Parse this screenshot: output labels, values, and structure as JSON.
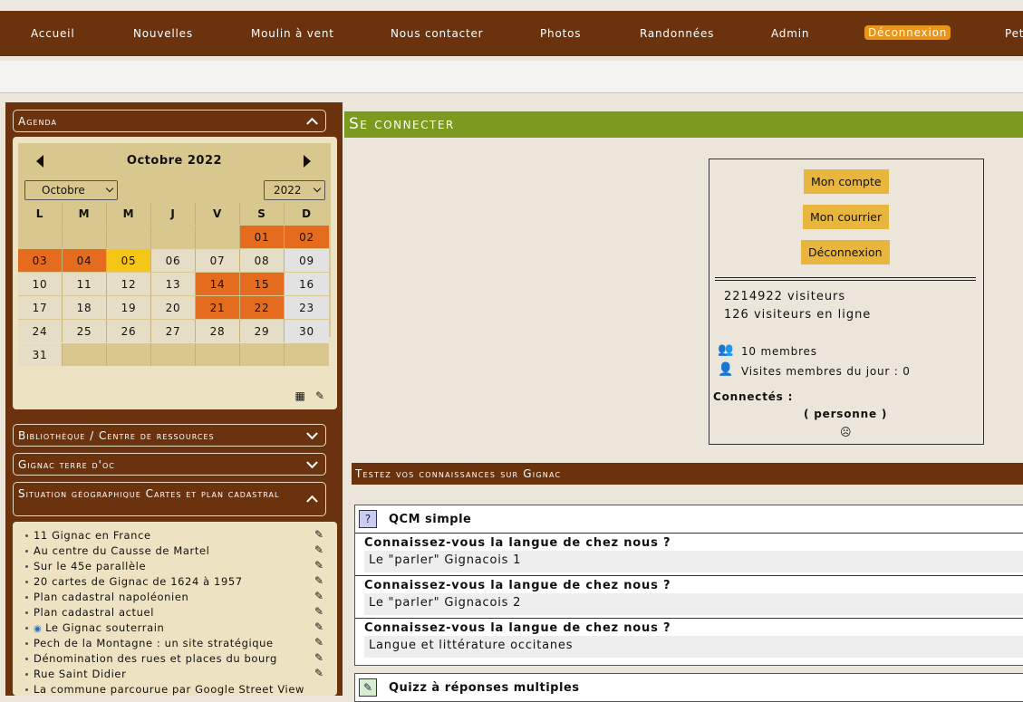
{
  "nav": {
    "items": [
      "Accueil",
      "Nouvelles",
      "Moulin à vent",
      "Nous contacter",
      "Photos",
      "Randonnées",
      "Admin",
      "Déconnexion",
      "Pet"
    ]
  },
  "sidebar": {
    "agenda_label": "Agenda",
    "calendar": {
      "title": "Octobre 2022",
      "month_select": "Octobre",
      "year_select": "2022",
      "weekdays": [
        "L",
        "M",
        "M",
        "J",
        "V",
        "S",
        "D"
      ],
      "weeks": [
        [
          "",
          "",
          "",
          "",
          "",
          "01",
          "02"
        ],
        [
          "03",
          "04",
          "05",
          "06",
          "07",
          "08",
          "09"
        ],
        [
          "10",
          "11",
          "12",
          "13",
          "14",
          "15",
          "16"
        ],
        [
          "17",
          "18",
          "19",
          "20",
          "21",
          "22",
          "23"
        ],
        [
          "24",
          "25",
          "26",
          "27",
          "28",
          "29",
          "30"
        ],
        [
          "31",
          "",
          "",
          "",
          "",
          "",
          ""
        ]
      ]
    },
    "sections": [
      "Bibliothèque / Centre de ressources",
      "Gignac terre d'oc",
      "Situation géographique Cartes et plan cadastral"
    ],
    "links": [
      "11 Gignac en France",
      "Au centre du Causse de Martel",
      "Sur le 45e parallèle",
      "20 cartes de Gignac de 1624 à 1957",
      "Plan cadastral napoléonien",
      "Plan cadastral actuel",
      "Le Gignac souterrain",
      "Pech de la Montagne : un site stratégique",
      "Dénomination des rues et places du bourg",
      "Rue Saint Didier",
      "La commune parcourue par Google Street View"
    ]
  },
  "main": {
    "title": "Se connecter",
    "login": {
      "btn_account": "Mon compte",
      "btn_mail": "Mon courrier",
      "btn_logout": "Déconnexion",
      "visitors": "2214922 visiteurs",
      "online": "126 visiteurs en ligne",
      "members": "10 membres",
      "visits_today": "Visites membres du jour : 0",
      "connected_label": "Connectés :",
      "connected_value": "( personne )",
      "sad_face": "☹"
    },
    "quiz_section": "Testez vos connaissances sur Gignac",
    "quiz1": {
      "title": "QCM simple",
      "items": [
        {
          "q": "Connaissez-vous la langue de chez nous ?",
          "a": "Le \"parler\" Gignacois 1"
        },
        {
          "q": "Connaissez-vous la langue de chez nous ?",
          "a": "Le \"parler\" Gignacois 2"
        },
        {
          "q": "Connaissez-vous la langue de chez nous ?",
          "a": "Langue et littérature occitanes"
        }
      ]
    },
    "quiz2": {
      "title": "Quizz à réponses multiples"
    }
  }
}
